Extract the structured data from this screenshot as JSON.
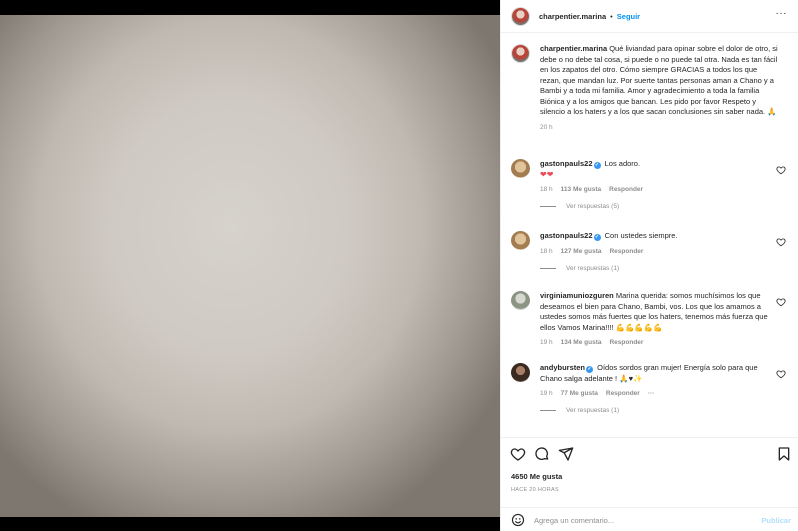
{
  "header": {
    "username": "charpentier.marina",
    "separator": "•",
    "follow_label": "Seguir",
    "more_label": "···"
  },
  "caption": {
    "username": "charpentier.marina",
    "text": "Qué liviandad para opinar sobre el dolor de otro, si debe o no debe tal cosa, si puede o no puede tal otra. Nada es tan fácil en los zapatos del otro. Cómo siempre GRACIAS a todos los que rezan, que mandan luz. Por suerte tantas personas aman a Chano y a Bambi y a toda mi familia. Amor y agradecimiento a toda la familia Biónica y a los amigos que bancan. Les pido por favor Respeto y silencio a los haters y a los que sacan conclusiones sin saber nada. 🙏",
    "time": "20 h"
  },
  "comments": [
    {
      "username": "gastonpauls22",
      "text": "Los adoro.",
      "emoji_line": "❤❤",
      "time": "18 h",
      "likes": "113 Me gusta",
      "reply_label": "Responder",
      "replies_label": "Ver respuestas (5)"
    },
    {
      "username": "gastonpauls22",
      "text": "Con ustedes siempre.",
      "time": "18 h",
      "likes": "127 Me gusta",
      "reply_label": "Responder",
      "replies_label": "Ver respuestas (1)"
    },
    {
      "username": "virginiamuniozguren",
      "text": "Marina querida: somos muchísimos los que deseamos el bien para Chano, Bambi, vos. Los que los amamos a ustedes somos más fuertes que los haters, tenemos más fuerza que ellos Vamos Marina!!!! 💪💪💪💪💪",
      "time": "19 h",
      "likes": "134 Me gusta",
      "reply_label": "Responder"
    },
    {
      "username": "andybursten",
      "text": "Oídos sordos gran mujer! Energía solo para que Chano salga adelante ! 🙏♥✨",
      "time": "19 h",
      "likes": "77 Me gusta",
      "reply_label": "Responder",
      "more_label": "···",
      "replies_label": "Ver respuestas (1)"
    }
  ],
  "footer": {
    "likes": "4650 Me gusta",
    "time": "HACE 20 HORAS",
    "comment_placeholder": "Agrega un comentario...",
    "publish_label": "Publicar"
  },
  "colors": {
    "accent": "#0095f6",
    "verified": "#3897f0",
    "muted": "#8e8e8e",
    "publish_disabled": "#b2dffc"
  }
}
